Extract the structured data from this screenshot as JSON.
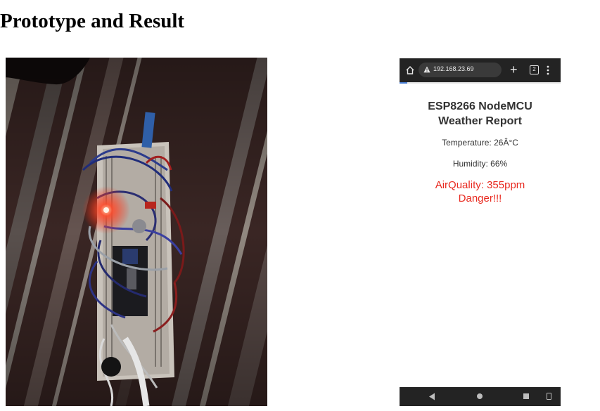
{
  "heading": "Prototype and Result",
  "photo": {
    "subject": "breadboard-circuit-photo"
  },
  "browser": {
    "url": "192.168.23.69",
    "tab_count": "2",
    "load_progress": 0.05
  },
  "report": {
    "title": "ESP8266 NodeMCU Weather Report",
    "temperature": "Temperature: 26Â°C",
    "humidity": "Humidity: 66%",
    "air_quality": "AirQuality: 355ppm Danger!!!"
  },
  "colors": {
    "danger": "#e8281e",
    "chrome_bar": "#232323"
  }
}
